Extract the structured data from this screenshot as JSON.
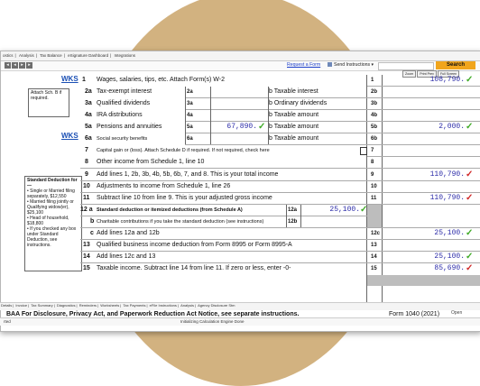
{
  "top_tabs": [
    "ostics",
    "Analysis",
    "Tax Balance",
    "eSignature Dashboard",
    "Integrations"
  ],
  "toolbar": {
    "request_link": "Request a Form",
    "send_instructions": "Send Instructions",
    "search_button": "Search",
    "small_buttons": [
      "Zoom",
      "Print Prev",
      "Full Screen"
    ]
  },
  "wks_label": "WKS",
  "sidebars": {
    "attach": "Attach Sch. B if required.",
    "std_title": "Standard Deduction for—",
    "std_items": [
      "• Single or Married filing separately, $12,550",
      "• Married filing jointly or Qualifying widow(er), $25,100",
      "• Head of household, $18,800",
      "• If you checked any box under Standard Deduction, see instructions."
    ]
  },
  "lines": {
    "l1": {
      "num": "1",
      "desc": "Wages, salaries, tips, etc. Attach Form(s) W-2",
      "box": "1",
      "value": "108,790."
    },
    "l2a": {
      "num": "2a",
      "desc": "Tax-exempt interest",
      "box": "2a"
    },
    "l2b": {
      "desc": "b Taxable interest",
      "box": "2b"
    },
    "l3a": {
      "num": "3a",
      "desc": "Qualified dividends",
      "box": "3a"
    },
    "l3b": {
      "desc": "b Ordinary dividends",
      "box": "3b"
    },
    "l4a": {
      "num": "4a",
      "desc": "IRA distributions",
      "box": "4a"
    },
    "l4b": {
      "desc": "b Taxable amount",
      "box": "4b"
    },
    "l5a": {
      "num": "5a",
      "desc": "Pensions and annuities",
      "box": "5a",
      "value": "67,890."
    },
    "l5b": {
      "desc": "b Taxable amount",
      "box": "5b",
      "value": "2,000."
    },
    "l6a": {
      "num": "6a",
      "desc": "Social security benefits",
      "box": "6a"
    },
    "l6b": {
      "desc": "b Taxable amount",
      "box": "6b"
    },
    "l7": {
      "num": "7",
      "desc": "Capital gain or (loss). Attach Schedule D if required. If not required, check here",
      "box": "7"
    },
    "l8": {
      "num": "8",
      "desc": "Other income from Schedule 1, line 10",
      "box": "8"
    },
    "l9": {
      "num": "9",
      "desc": "Add lines 1, 2b, 3b, 4b, 5b, 6b, 7, and 8. This is your total income",
      "box": "9",
      "value": "110,790."
    },
    "l10": {
      "num": "10",
      "desc": "Adjustments to income from Schedule 1, line 26",
      "box": "10"
    },
    "l11": {
      "num": "11",
      "desc": "Subtract line 10 from line 9. This is your adjusted gross income",
      "box": "11",
      "value": "110,790."
    },
    "l12a": {
      "num": "12 a",
      "desc": "Standard deduction or itemized deductions (from Schedule A)",
      "box": "12a",
      "value": "25,100."
    },
    "l12b": {
      "num": "b",
      "desc": "Charitable contributions if you take the standard deduction (see instructions)",
      "box": "12b"
    },
    "l12c": {
      "num": "c",
      "desc": "Add lines 12a and 12b",
      "box": "12c",
      "value": "25,100."
    },
    "l13": {
      "num": "13",
      "desc": "Qualified business income deduction from Form 8995 or Form 8995-A",
      "box": "13"
    },
    "l14": {
      "num": "14",
      "desc": "Add lines 12c and 13",
      "box": "14",
      "value": "25,100."
    },
    "l15": {
      "num": "15",
      "desc": "Taxable income. Subtract line 14 from line 11. If zero or less, enter -0-",
      "box": "15",
      "value": "85,690."
    }
  },
  "footer": {
    "baa": "BAA  For Disclosure, Privacy Act, and Paperwork Reduction Act Notice, see separate instructions.",
    "form": "Form 1040 (2021)"
  },
  "bottom_tabs": [
    "Details",
    "Invoice",
    "Tax Summary",
    "Diagnostics",
    "Reminders",
    "Worksheets",
    "Tax Payments",
    "eFile Instructions",
    "Analysis",
    "Agency Disclosure Stm"
  ],
  "open_label": "Open",
  "status": {
    "left": "rted",
    "center": "Initializing Calculation Engine Done"
  },
  "colors": {
    "accent_check": "#3faa26",
    "alert_check": "#d12828",
    "values": "#2b2ba8",
    "background_circle": "#d2b280"
  }
}
